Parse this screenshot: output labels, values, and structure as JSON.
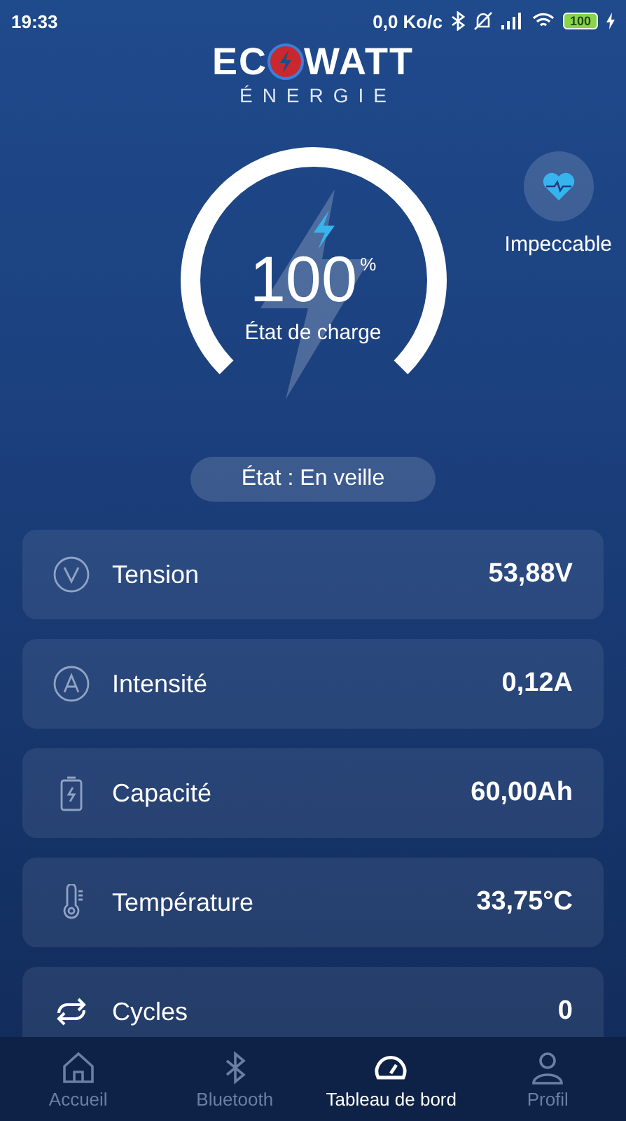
{
  "status_bar": {
    "time": "19:33",
    "speed": "0,0 Ko/c",
    "battery": "100"
  },
  "logo": {
    "left": "EC",
    "right": "WATT",
    "subtitle": "ÉNERGIE"
  },
  "gauge": {
    "value": "100",
    "unit": "%",
    "label": "État de charge"
  },
  "health": {
    "label": "Impeccable"
  },
  "state": {
    "text": "État : En veille"
  },
  "metrics": [
    {
      "kind": "voltage",
      "label": "Tension",
      "value": "53,88V"
    },
    {
      "kind": "current",
      "label": "Intensité",
      "value": "0,12A"
    },
    {
      "kind": "battery",
      "label": "Capacité",
      "value": "60,00Ah"
    },
    {
      "kind": "temperature",
      "label": "Température",
      "value": "33,75°C"
    },
    {
      "kind": "cycles",
      "label": "Cycles",
      "value": "0"
    }
  ],
  "nav": [
    {
      "kind": "home",
      "label": "Accueil",
      "selected": false
    },
    {
      "kind": "bluetooth",
      "label": "Bluetooth",
      "selected": false
    },
    {
      "kind": "dashboard",
      "label": "Tableau de bord",
      "selected": true
    },
    {
      "kind": "profile",
      "label": "Profil",
      "selected": false
    }
  ]
}
